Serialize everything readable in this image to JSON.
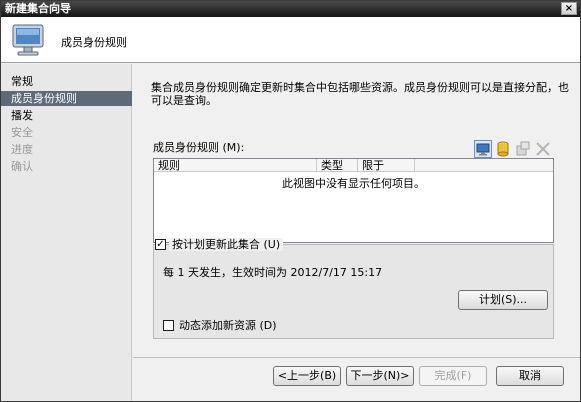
{
  "window": {
    "title": "新建集合向导",
    "close_glyph": "×"
  },
  "header": {
    "title": "成员身份规则",
    "icon": "computer-monitor-icon"
  },
  "nav": {
    "items": [
      {
        "label": "常规",
        "state": "normal"
      },
      {
        "label": "成员身份规则",
        "state": "selected"
      },
      {
        "label": "播发",
        "state": "normal"
      },
      {
        "label": "安全",
        "state": "disabled"
      },
      {
        "label": "进度",
        "state": "disabled"
      },
      {
        "label": "确认",
        "state": "disabled"
      }
    ]
  },
  "main": {
    "description": "集合成员身份规则确定更新时集合中包括哪些资源。成员身份规则可以是直接分配，也可以是查询。",
    "rules_label": "成员身份规则 (M):",
    "toolbar": [
      "new-rule-icon",
      "database-icon",
      "properties-icon",
      "delete-icon"
    ],
    "list": {
      "columns": [
        "规则",
        "类型",
        "限于"
      ],
      "empty_text": "此视图中没有显示任何项目。"
    },
    "schedule": {
      "checkbox_label": "按计划更新此集合 (U)",
      "checked": true,
      "text": "每 1 天发生，生效时间为 2012/7/17 15:17",
      "button": "计划(S)..."
    },
    "dynamic": {
      "checkbox_label": "动态添加新资源 (D)",
      "checked": false
    }
  },
  "footer": {
    "back": "<上一步(B)",
    "next": "下一步(N)>",
    "finish": "完成(F)",
    "cancel": "取消"
  },
  "colors": {
    "nav_selected": "#5f6a78",
    "title_bar": "#1e1e1e"
  }
}
